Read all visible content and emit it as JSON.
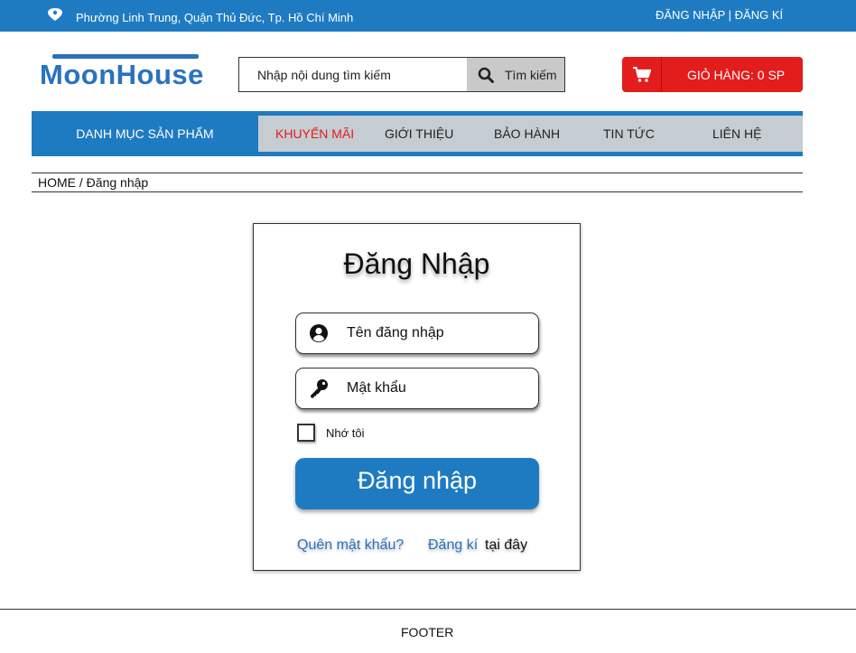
{
  "topbar": {
    "address": "Phường Linh Trung, Quận Thủ Đức, Tp. Hồ Chí Minh",
    "login_link": "ĐĂNG NHẬP",
    "separator": " | ",
    "register_link": "ĐĂNG KÍ",
    "location_icon": "location-pin-icon"
  },
  "header": {
    "logo_text": "MoonHouse",
    "search_placeholder": "Nhập nội dung tìm kiếm",
    "search_button": "Tìm kiếm",
    "search_icon": "search-icon",
    "cart_label": "GIỎ HÀNG: 0 SP",
    "cart_icon": "shopping-cart-icon"
  },
  "nav": {
    "category_label": "DANH MỤC SẢN PHẨM",
    "items": [
      {
        "label": "KHUYẾN MÃI",
        "active": true
      },
      {
        "label": "GIỚI THIỆU",
        "active": false
      },
      {
        "label": "BẢO HÀNH",
        "active": false
      },
      {
        "label": "TIN TỨC",
        "active": false
      },
      {
        "label": "LIÊN HỆ",
        "active": false
      }
    ]
  },
  "breadcrumb": "HOME / Đăng nhập",
  "login": {
    "title": "Đăng Nhập",
    "username_placeholder": "Tên đăng nhập",
    "username_icon": "user-icon",
    "password_placeholder": "Mật khẩu",
    "password_icon": "key-icon",
    "remember_label": "Nhớ tôi",
    "remember_checked": false,
    "submit_label": "Đăng nhập",
    "forgot_link": "Quên mật khẩu?",
    "register_link": "Đăng kí",
    "register_suffix": "tại đây"
  },
  "footer": {
    "label": "FOOTER"
  },
  "colors": {
    "primary": "#1e7bc2",
    "cart_red": "#e31c1c",
    "menu_bg": "#c5ccd2",
    "active_nav": "#e31c1c"
  }
}
